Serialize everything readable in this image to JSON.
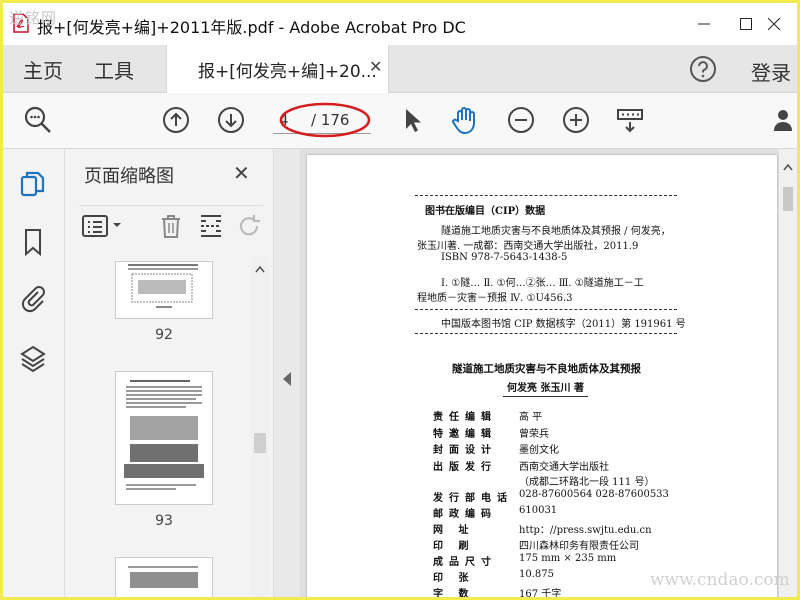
{
  "watermark_top_left": "逆铭网",
  "titlebar": {
    "title": "报+[何发亮+编]+2011年版.pdf - Adobe Acrobat Pro DC"
  },
  "tabs": {
    "home": "主页",
    "tools": "工具",
    "doc_tab": "报+[何发亮+编]+20...",
    "login": "登录"
  },
  "toolbar": {
    "page_current": "4",
    "page_total_label": "/ 176"
  },
  "panel": {
    "title": "页面缩略图",
    "thumb_labels": [
      "92",
      "93"
    ]
  },
  "pdf": {
    "cip_header": "图书在版编目（CIP）数据",
    "cip_line1": "隧道施工地质灾害与不良地质体及其预报 / 何发亮，",
    "cip_line2": "张玉川著. 一成都：西南交通大学出版社，2011.9",
    "cip_line3": "ISBN 978-7-5643-1438-5",
    "cip_line4": "Ⅰ. ①隧…  Ⅱ. ①何…②张…  Ⅲ. ①隧道施工－工",
    "cip_line5": "程地质－灾害－预报  Ⅳ. ①U456.3",
    "cip_number": "中国版本图书馆 CIP 数据核字（2011）第 191961 号",
    "book_title": "隧道施工地质灾害与不良地质体及其预报",
    "authors": "何发亮  张玉川  著",
    "colophon": [
      {
        "label": "责任编辑",
        "value": "高  平"
      },
      {
        "label": "特邀编辑",
        "value": "曾荣兵"
      },
      {
        "label": "封面设计",
        "value": "墨创文化"
      },
      {
        "label": "出版发行",
        "value": "西南交通大学出版社"
      },
      {
        "label": "",
        "value": "（成都二环路北一段 111 号）"
      },
      {
        "label": "发行部电话",
        "value": "028-87600564   028-87600533"
      },
      {
        "label": "邮政编码",
        "value": "610031"
      },
      {
        "label": "网    址",
        "value": "http：//press.swjtu.edu.cn"
      },
      {
        "label": "印    刷",
        "value": "四川森林印务有限责任公司"
      },
      {
        "label": "成品尺寸",
        "value": "175 mm × 235 mm"
      },
      {
        "label": "印    张",
        "value": "10.875"
      },
      {
        "label": "字    数",
        "value": "167 千字"
      }
    ]
  },
  "watermark_bottom_right": "www.cndao.com",
  "colors": {
    "accent": "#1e73be",
    "annotation_ellipse": "#d41d1d",
    "frame": "#f0ec4e"
  }
}
